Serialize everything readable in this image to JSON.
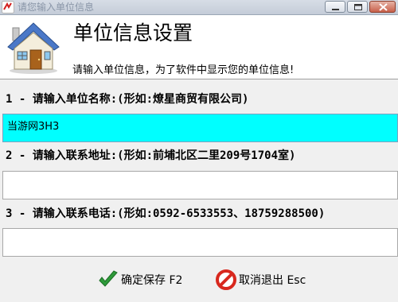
{
  "window": {
    "title": "请您输入单位信息"
  },
  "header": {
    "title": "单位信息设置",
    "subtitle": "请输入单位信息，为了软件中显示您的单位信息!"
  },
  "fields": [
    {
      "label": "1 - 请输入单位名称:(形如:燎星商贸有限公司)",
      "value": "当游网3H3"
    },
    {
      "label": "2 - 请输入联系地址:(形如:前埔北区二里209号1704室)",
      "value": ""
    },
    {
      "label": "3 - 请输入联系电话:(形如:0592-6533553、18759288500)",
      "value": ""
    }
  ],
  "buttons": {
    "confirm_label": "确定保存 F2",
    "cancel_label": "取消退出 Esc"
  },
  "colors": {
    "active_field": "#00ffff",
    "confirm_icon": "#2e9a3a",
    "cancel_icon": "#d8281e"
  }
}
